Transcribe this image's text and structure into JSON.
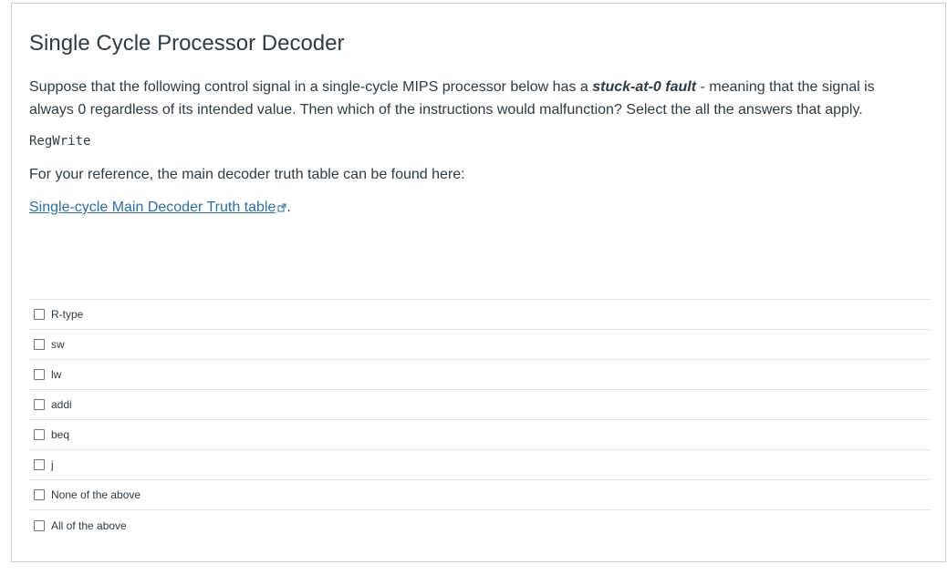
{
  "question": {
    "title": "Single Cycle Processor Decoder",
    "text_before": "Suppose that the following control signal in a single-cycle MIPS processor below has a ",
    "emphasis": "stuck-at-0 fault",
    "text_after": " - meaning that the signal is always 0 regardless of its intended value. Then which of the instructions would malfunction? Select the all the answers that apply.",
    "signal": "RegWrite",
    "reference_text": "For your reference, the main decoder truth table can be found here:",
    "link_text": "Single-cycle Main Decoder Truth table",
    "link_suffix": "."
  },
  "answers": [
    {
      "label": "R-type",
      "checked": false
    },
    {
      "label": "sw",
      "checked": false
    },
    {
      "label": "lw",
      "checked": false
    },
    {
      "label": "addi",
      "checked": false
    },
    {
      "label": "beq",
      "checked": false
    },
    {
      "label": "j",
      "checked": false
    },
    {
      "label": "None of the above",
      "checked": false
    },
    {
      "label": "All of the above",
      "checked": false
    }
  ],
  "colors": {
    "link": "#2d6fa3",
    "text": "#2d3b45",
    "divider": "#dfe3e6",
    "border": "#c7cdd1"
  }
}
